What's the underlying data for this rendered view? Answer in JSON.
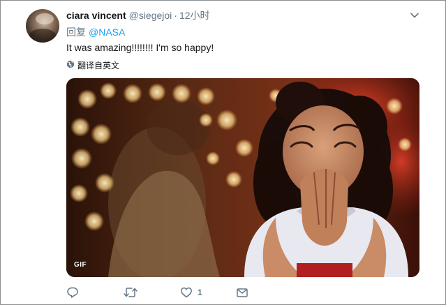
{
  "tweet": {
    "display_name": "ciara vincent",
    "handle": "@siegejoi",
    "separator": "·",
    "time": "12小时",
    "reply_prefix": "回复",
    "reply_to": "@NASA",
    "text": "It was amazing!!!!!!!! I'm so happy!",
    "translate_label": "翻译自英文",
    "media": {
      "badge": "GIF"
    },
    "actions": {
      "reply_count": "",
      "retweet_count": "",
      "like_count": "1"
    }
  },
  "colors": {
    "accent": "#1da1f2",
    "secondary_text": "#657786",
    "primary_text": "#14171a",
    "border": "#8a8d90"
  },
  "icons": [
    "chevron-down-icon",
    "globe-icon",
    "reply-icon",
    "retweet-icon",
    "heart-icon",
    "message-icon"
  ]
}
